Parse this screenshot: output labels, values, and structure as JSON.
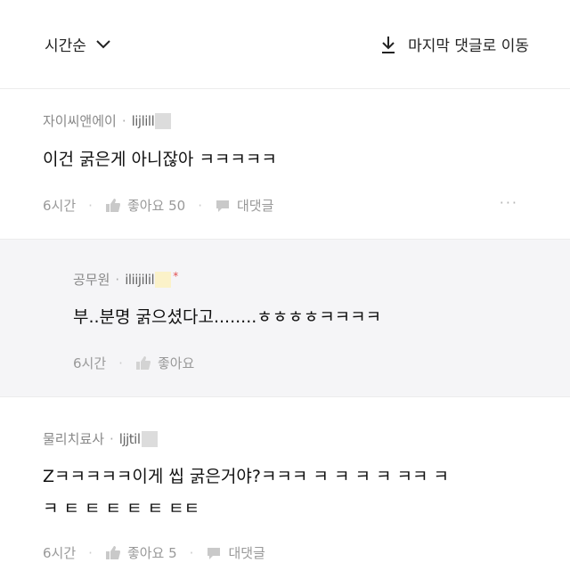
{
  "toolbar": {
    "sort_label": "시간순",
    "jump_label": "마지막 댓글로 이동"
  },
  "comments": [
    {
      "author": "자이씨앤에이",
      "user_id": "lijlill",
      "text": "이건 굵은게 아니잖아 ㅋㅋㅋㅋㅋ",
      "time": "6시간",
      "like_label": "좋아요 50",
      "reply_label": "대댓글",
      "more": "···"
    },
    {
      "author": "공무원",
      "user_id": "iliijilil",
      "star": "*",
      "text": "부..분명 굵으셨다고........ㅎㅎㅎㅎㅋㅋㅋㅋ",
      "time": "6시간",
      "like_label": "좋아요"
    },
    {
      "author": "물리치료사",
      "user_id": "ljjtil",
      "text_line1": "Zㅋㅋㅋㅋㅋ이게 씹 굵은거야?ㅋㅋㅋ ㅋ ㅋ ㅋ ㅋ ㅋㅋ ㅋ",
      "text_line2": "ㅋ ㅌ ㅌ ㅌ ㅌ ㅌ ㅌㅌ",
      "time": "6시간",
      "like_label": "좋아요 5",
      "reply_label": "대댓글"
    }
  ]
}
